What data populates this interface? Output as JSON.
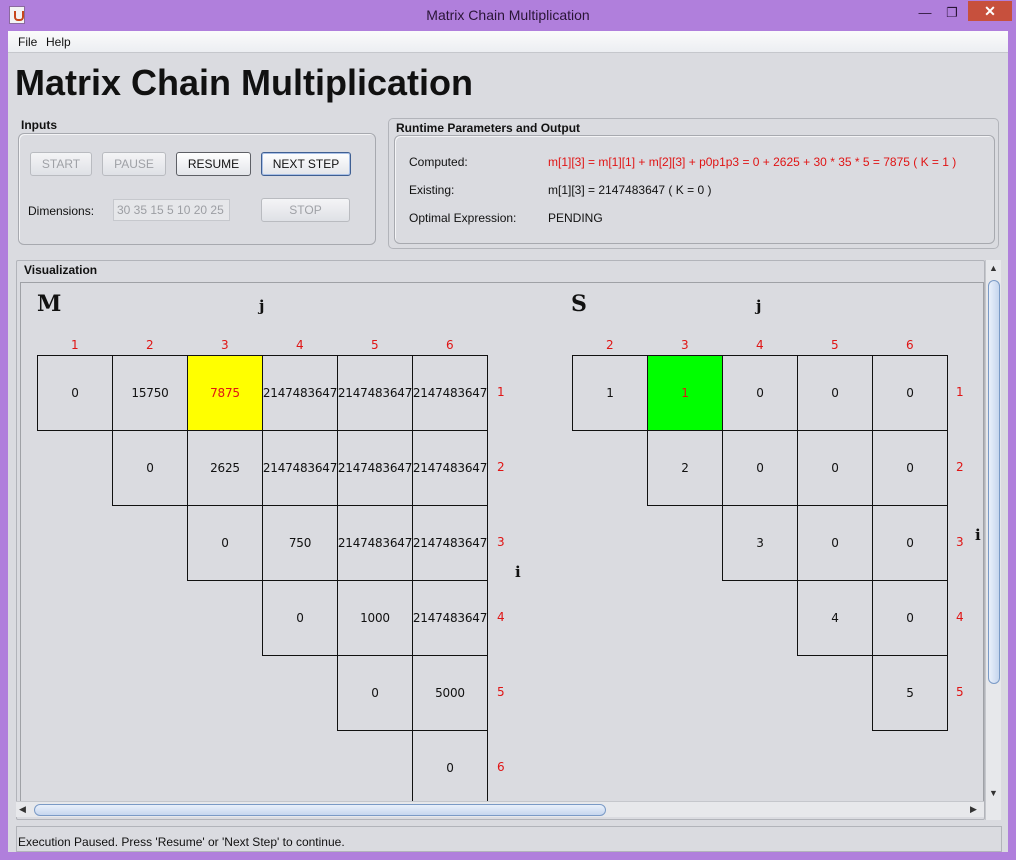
{
  "window": {
    "title": "Matrix Chain Multiplication",
    "minimize": "—",
    "maximize": "❐",
    "close": "✕"
  },
  "menu": {
    "file": "File",
    "help": "Help"
  },
  "header": {
    "title": "Matrix Chain Multiplication"
  },
  "inputs": {
    "label": "Inputs",
    "start": "START",
    "pause": "PAUSE",
    "resume": "RESUME",
    "next_step": "NEXT STEP",
    "stop": "STOP",
    "dimensions_label": "Dimensions:",
    "dimensions_value": "30 35 15 5 10 20 25"
  },
  "runtime": {
    "label": "Runtime Parameters and Output",
    "computed_label": "Computed:",
    "computed_value": "m[1][3] = m[1][1] + m[2][3] + p0p1p3 = 0 + 2625 + 30 * 35 * 5 = 7875 ( K = 1 )",
    "existing_label": "Existing:",
    "existing_value": "m[1][3] = 2147483647 ( K = 0 )",
    "optimal_label": "Optimal Expression:",
    "optimal_value": "PENDING"
  },
  "visualization": {
    "label": "Visualization",
    "m": {
      "name": "M",
      "j": "j",
      "i": "i",
      "cols": [
        "1",
        "2",
        "3",
        "4",
        "5",
        "6"
      ],
      "rows": [
        "1",
        "2",
        "3",
        "4",
        "5",
        "6"
      ],
      "cells": [
        [
          "0",
          "15750",
          "7875",
          "2147483647",
          "2147483647",
          "2147483647"
        ],
        [
          "0",
          "2625",
          "2147483647",
          "2147483647",
          "2147483647"
        ],
        [
          "0",
          "750",
          "2147483647",
          "2147483647"
        ],
        [
          "0",
          "1000",
          "2147483647"
        ],
        [
          "0",
          "5000"
        ],
        [
          "0"
        ]
      ],
      "highlight": {
        "row": 1,
        "col": 3,
        "color": "#ffff00"
      }
    },
    "s": {
      "name": "S",
      "j": "j",
      "i": "i",
      "cols": [
        "2",
        "3",
        "4",
        "5",
        "6"
      ],
      "rows": [
        "1",
        "2",
        "3",
        "4",
        "5"
      ],
      "cells": [
        [
          "1",
          "1",
          "0",
          "0",
          "0"
        ],
        [
          "2",
          "0",
          "0",
          "0"
        ],
        [
          "3",
          "0",
          "0"
        ],
        [
          "4",
          "0"
        ],
        [
          "5"
        ]
      ],
      "highlight": {
        "row": 1,
        "col": 3,
        "color": "#00ff00"
      }
    }
  },
  "status": {
    "text": "Execution Paused. Press 'Resume' or 'Next Step' to continue."
  },
  "scroll": {
    "up": "▲",
    "down": "▼",
    "left": "◀",
    "right": "▶"
  }
}
